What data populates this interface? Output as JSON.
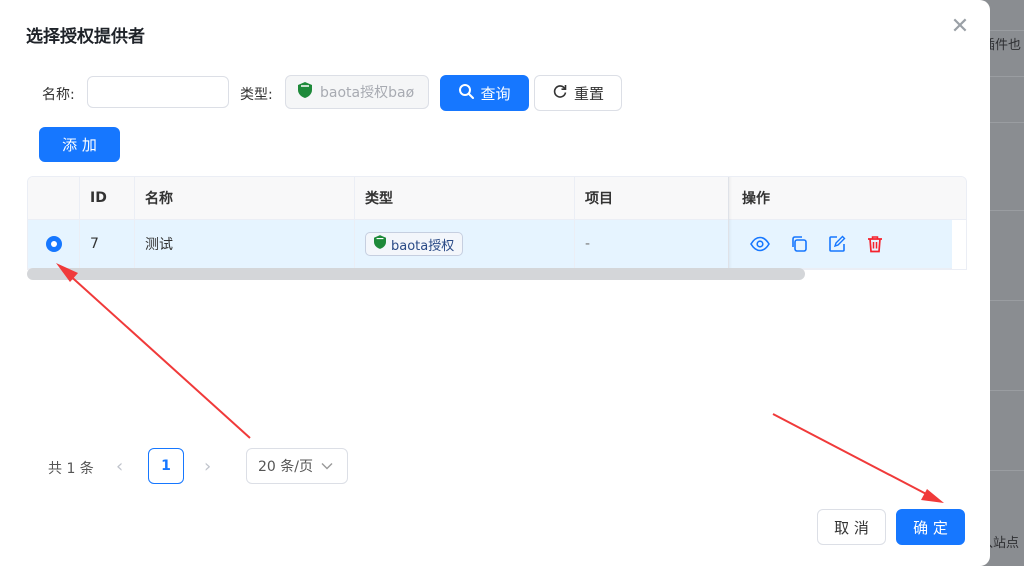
{
  "dialog": {
    "title": "选择授权提供者",
    "close_symbol": "✕"
  },
  "background_page": {
    "top_text": "插件也",
    "bottom_text": "入站点"
  },
  "filters": {
    "name_label": "名称:",
    "name_value": "",
    "type_label": "类型:",
    "type_value": "baota授权baø",
    "query_label": "查询",
    "reset_label": "重置"
  },
  "toolbar": {
    "add_label": "添 加"
  },
  "table": {
    "columns": [
      "",
      "ID",
      "名称",
      "类型",
      "项目",
      "操作"
    ],
    "rows": [
      {
        "selected": true,
        "id": "7",
        "name": "测试",
        "type": "baota授权",
        "project": "-"
      }
    ]
  },
  "pagination": {
    "total_text": "共 1 条",
    "prev_symbol": "‹",
    "current_page": "1",
    "next_symbol": "›",
    "page_size": "20 条/页"
  },
  "footer": {
    "cancel_label": "取 消",
    "confirm_label": "确 定"
  },
  "colors": {
    "primary": "#1677ff",
    "danger": "#f5222d",
    "annotation_arrow": "#f03a3a",
    "row_selected": "#e6f4ff"
  }
}
